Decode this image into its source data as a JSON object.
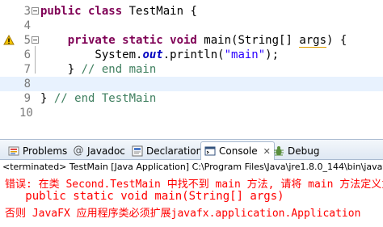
{
  "editor": {
    "lines": [
      {
        "num": "3",
        "parts": [
          {
            "t": "public class",
            "c": "kw"
          },
          {
            "t": " TestMain {",
            "c": ""
          }
        ]
      },
      {
        "num": "4",
        "parts": []
      },
      {
        "num": "5",
        "parts": [
          {
            "t": "    private static void",
            "c": "kw"
          },
          {
            "t": " main(String[] ",
            "c": ""
          },
          {
            "t": "args",
            "c": "squiggle"
          },
          {
            "t": ") {",
            "c": ""
          }
        ]
      },
      {
        "num": "6",
        "parts": [
          {
            "t": "        System.",
            "c": ""
          },
          {
            "t": "out",
            "c": "it"
          },
          {
            "t": ".println(",
            "c": ""
          },
          {
            "t": "\"main\"",
            "c": "str"
          },
          {
            "t": ");",
            "c": ""
          }
        ]
      },
      {
        "num": "7",
        "parts": [
          {
            "t": "    } ",
            "c": ""
          },
          {
            "t": "// end main",
            "c": "cmt"
          }
        ]
      },
      {
        "num": "8",
        "parts": []
      },
      {
        "num": "9",
        "parts": [
          {
            "t": "} ",
            "c": ""
          },
          {
            "t": "// end TestMain",
            "c": "cmt"
          }
        ]
      },
      {
        "num": "10",
        "parts": []
      }
    ]
  },
  "tabs": [
    {
      "label": "Problems",
      "icon": "problems-icon"
    },
    {
      "label": "Javadoc",
      "icon": "at-icon"
    },
    {
      "label": "Declaration",
      "icon": "declaration-icon"
    },
    {
      "label": "Console",
      "icon": "console-icon",
      "active": true,
      "close": "✕"
    },
    {
      "label": "Debug",
      "icon": "debug-icon"
    }
  ],
  "console": {
    "status": "<terminated> TestMain [Java Application] C:\\Program Files\\Java\\jre1.8.0_144\\bin\\javaw.exe",
    "line1": "错误: 在类 Second.TestMain 中找不到 main 方法, 请将 main 方法定义为:",
    "line2": "   public static void main(String[] args)",
    "line3": "否则 JavaFX 应用程序类必须扩展javafx.application.Application",
    "color": "#ff0000"
  }
}
